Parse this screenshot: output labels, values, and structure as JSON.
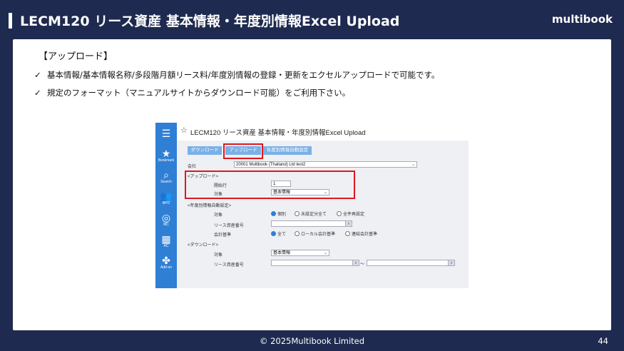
{
  "slide": {
    "title": "LECM120 リース資産 基本情報・年度別情報Excel Upload",
    "brand": "multibook",
    "section_title": "【アップロード】",
    "bullets": [
      "基本情報/基本情報名称/多段階月額リース料/年度別情報の登録・更新をエクセルアップロードで可能です。",
      "規定のフォーマット（マニュアルサイトからダウンロード可能）をご利用下さい。"
    ],
    "check_mark": "✓",
    "footer": "© 2025Multibook Limited",
    "page_number": "44"
  },
  "app": {
    "title": "LECM120 リース資産 基本情報・年度別情報Excel Upload",
    "nav": [
      {
        "label": "Bookmark",
        "icon": "★"
      },
      {
        "label": "Search",
        "icon": "⌕"
      },
      {
        "label": "BPO",
        "icon": "👥"
      },
      {
        "label": "MC",
        "icon": "◎"
      },
      {
        "label": "AC",
        "icon": "▦"
      },
      {
        "label": "Add-on",
        "icon": "✤"
      }
    ],
    "menu_icon": "☰",
    "star_icon": "☆",
    "toolbar": {
      "download": "ダウンロード",
      "upload": "アップロード",
      "year_auto_setting": "年度別情報自動設定"
    },
    "company": {
      "label": "会社",
      "value": "20001 Multibook (Thailand) Ltd test2"
    },
    "upload_section": {
      "header": "<アップロード>",
      "start_row_label": "開始行",
      "start_row_value": "1",
      "target_label": "対象",
      "target_value": "基本情報"
    },
    "year_auto_section": {
      "header": "<年度別情報自動設定>",
      "target_label": "対象",
      "target_options": [
        "個別",
        "未設定分全て",
        "全件再設定"
      ],
      "lease_no_label": "リース資産番号",
      "accounting_label": "会計基準",
      "accounting_options": [
        "全て",
        "ローカル会計基準",
        "連結会計基準"
      ]
    },
    "download_section": {
      "header": "<ダウンロード>",
      "target_label": "対象",
      "target_value": "基本情報",
      "lease_no_label": "リース資産番号",
      "range_sep": "〜"
    }
  }
}
